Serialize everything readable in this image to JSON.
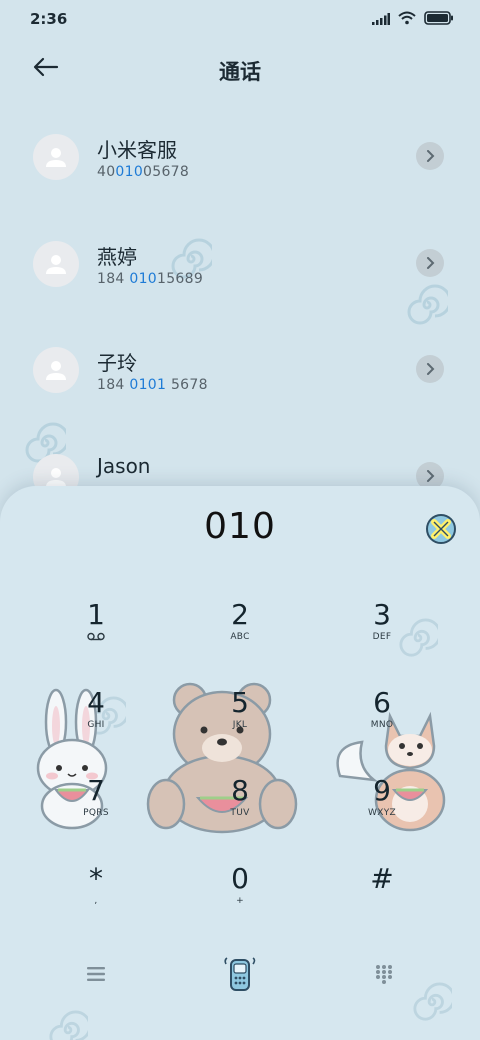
{
  "status_bar": {
    "time": "2:36",
    "icons": [
      "signal-icon",
      "wifi-icon",
      "battery-icon"
    ]
  },
  "header": {
    "back_icon": "back-arrow-icon",
    "title": "通话"
  },
  "contacts": [
    {
      "name": "小米客服",
      "number_prefix": "40",
      "number_match": "010",
      "number_suffix": "05678"
    },
    {
      "name": "燕婷",
      "number_prefix": "184 ",
      "number_match": "010",
      "number_suffix": "15689"
    },
    {
      "name": "子玲",
      "number_prefix": "184 ",
      "number_match": "0101",
      "number_suffix": " 5678"
    },
    {
      "name": "Jason",
      "number_prefix": "",
      "number_match": "",
      "number_suffix": ""
    }
  ],
  "dialer": {
    "input_value": "010",
    "backspace_icon": "backspace-icon",
    "keys": [
      {
        "digit": "1",
        "letters": "",
        "sub_icon": "voicemail-icon"
      },
      {
        "digit": "2",
        "letters": "ABC"
      },
      {
        "digit": "3",
        "letters": "DEF"
      },
      {
        "digit": "4",
        "letters": "GHI"
      },
      {
        "digit": "5",
        "letters": "JKL"
      },
      {
        "digit": "6",
        "letters": "MNO"
      },
      {
        "digit": "7",
        "letters": "PQRS"
      },
      {
        "digit": "8",
        "letters": "TUV"
      },
      {
        "digit": "9",
        "letters": "WXYZ"
      },
      {
        "digit": "*",
        "letters": ","
      },
      {
        "digit": "0",
        "letters": "+"
      },
      {
        "digit": "#",
        "letters": ""
      }
    ]
  },
  "bottom_bar": {
    "left_icon": "menu-icon",
    "center_icon": "call-phone-icon",
    "right_icon": "keypad-icon"
  },
  "colors": {
    "background": "#d3e4ec",
    "panel": "#d6e7ef",
    "highlight": "#1e7bd6",
    "text": "#1c2a33"
  }
}
